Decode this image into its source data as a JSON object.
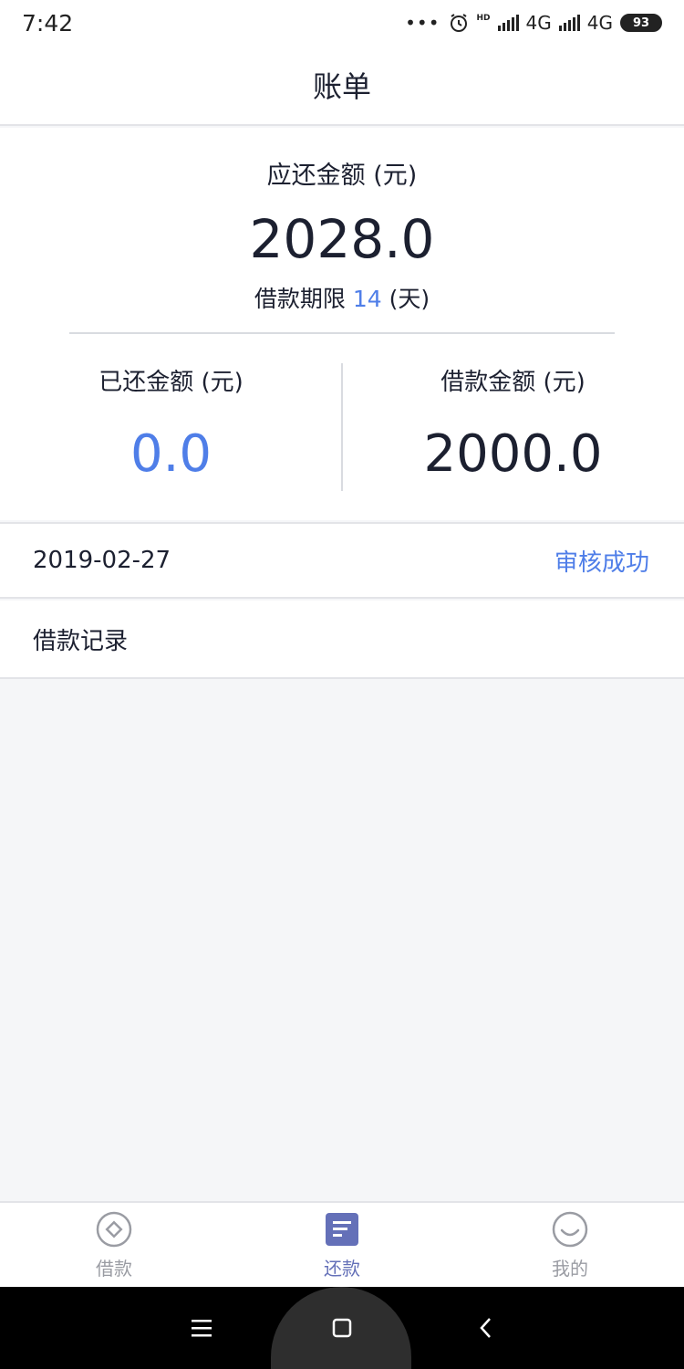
{
  "status_bar": {
    "time": "7:42",
    "dots": "•••",
    "network_1": "4G",
    "network_2": "4G",
    "battery": "93",
    "hd": "HD"
  },
  "header": {
    "title": "账单"
  },
  "summary": {
    "due_label": "应还金额 (元)",
    "due_amount": "2028.0",
    "term_prefix": "借款期限",
    "term_value": "14",
    "term_unit": "(天)",
    "repaid_label": "已还金额 (元)",
    "repaid_value": "0.0",
    "loan_label": "借款金额 (元)",
    "loan_value": "2000.0"
  },
  "status_row": {
    "date": "2019-02-27",
    "status": "审核成功"
  },
  "records": {
    "title": "借款记录"
  },
  "tabs": [
    {
      "label": "借款",
      "icon": "coin-circle-icon",
      "active": false
    },
    {
      "label": "还款",
      "icon": "document-icon",
      "active": true
    },
    {
      "label": "我的",
      "icon": "smiley-icon",
      "active": false
    }
  ],
  "nav": {
    "menu_icon": "menu-icon",
    "home_icon": "home-square-icon",
    "back_icon": "back-chevron-icon"
  },
  "colors": {
    "accent": "#4f7ee8",
    "tab_active": "#6470b8",
    "tab_inactive": "#9a9ca3",
    "page_bg": "#f5f6f8"
  }
}
